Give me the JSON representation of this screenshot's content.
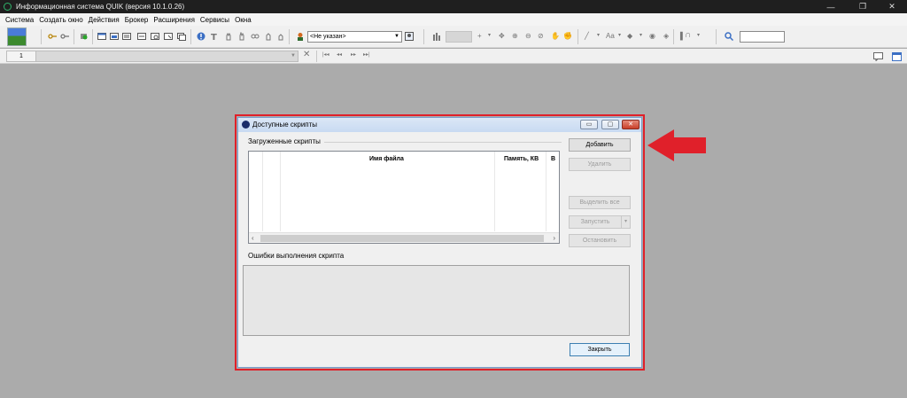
{
  "window": {
    "title": "Информационная система QUIK (версия 10.1.0.26)",
    "controls": [
      "—",
      "❐",
      "✕"
    ]
  },
  "menu": [
    "Система",
    "Создать окно",
    "Действия",
    "Брокер",
    "Расширения",
    "Сервисы",
    "Окна"
  ],
  "toolbar": {
    "client_select_value": "<Не указан>",
    "client_select_options_visible": [
      "<Не указан>"
    ]
  },
  "toolbar2": {
    "first_tab": "1"
  },
  "dialog": {
    "title": "Доступные скрипты",
    "loaded_group_label": "Загруженные скрипты",
    "columns": [
      "",
      "",
      "Имя файла",
      "Память, КВ",
      "В"
    ],
    "rows": [],
    "errors_group_label": "Ошибки выполнения скрипта",
    "buttons": {
      "add": "Добавить",
      "remove": "Удалить",
      "select_all": "Выделить все",
      "run": "Запустить",
      "stop": "Остановить",
      "close": "Закрыть"
    },
    "title_buttons": [
      "▭",
      "▢",
      "✕"
    ]
  },
  "colors": {
    "highlight": "#e0202a",
    "desktop": "#ababab",
    "titlebar": "#1f1f1f"
  }
}
